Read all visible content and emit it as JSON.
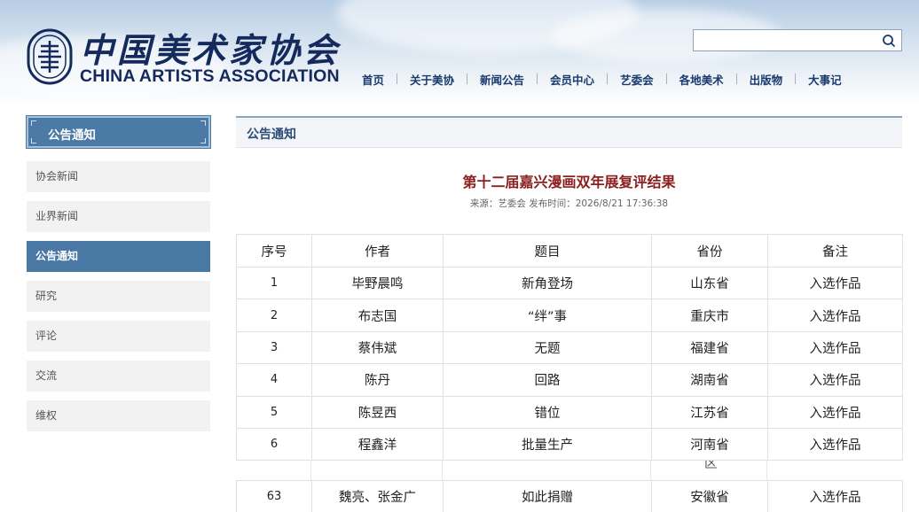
{
  "header": {
    "logo_cn": "中国美术家协会",
    "logo_en": "CHINA ARTISTS ASSOCIATION",
    "search": {
      "value": "",
      "placeholder": ""
    },
    "nav": [
      "首页",
      "关于美协",
      "新闻公告",
      "会员中心",
      "艺委会",
      "各地美术",
      "出版物",
      "大事记"
    ]
  },
  "sidebar": {
    "heading": "公告通知",
    "items": [
      {
        "label": "协会新闻",
        "active": false
      },
      {
        "label": "业界新闻",
        "active": false
      },
      {
        "label": "公告通知",
        "active": true
      },
      {
        "label": "研究",
        "active": false
      },
      {
        "label": "评论",
        "active": false
      },
      {
        "label": "交流",
        "active": false
      },
      {
        "label": "维权",
        "active": false
      }
    ]
  },
  "main": {
    "section_title": "公告通知",
    "article_title": "第十二届嘉兴漫画双年展复评结果",
    "meta": "来源：艺委会 发布时间：2026/8/21 17:36:38",
    "table": {
      "headers": [
        "序号",
        "作者",
        "题目",
        "省份",
        "备注"
      ],
      "rows": [
        [
          "1",
          "毕野晨鸣",
          "新角登场",
          "山东省",
          "入选作品"
        ],
        [
          "2",
          "布志国",
          "“绊”事",
          "重庆市",
          "入选作品"
        ],
        [
          "3",
          "蔡伟斌",
          "无题",
          "福建省",
          "入选作品"
        ],
        [
          "4",
          "陈丹",
          "回路",
          "湖南省",
          "入选作品"
        ],
        [
          "5",
          "陈昱西",
          "错位",
          "江苏省",
          "入选作品"
        ],
        [
          "6",
          "程鑫洋",
          "批量生产",
          "河南省",
          "入选作品"
        ]
      ],
      "clipped_fragment": "区",
      "tail_row": [
        "63",
        "魏亮、张金广",
        "如此捐赠",
        "安徽省",
        "入选作品"
      ]
    }
  },
  "colors": {
    "brand_navy": "#14295c",
    "sidebar_blue": "#4a78a5",
    "title_red": "#8b1f1f"
  }
}
